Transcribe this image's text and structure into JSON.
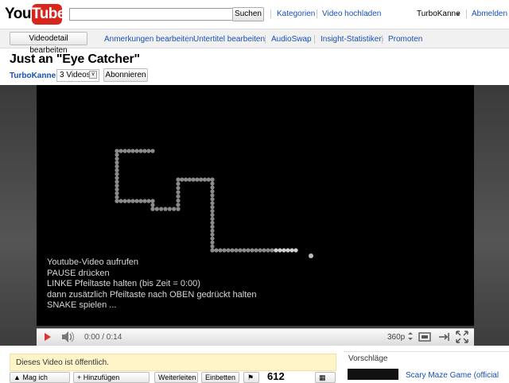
{
  "header": {
    "logo_you": "You",
    "logo_tube": "Tube",
    "search_value": "",
    "search_button": "Suchen",
    "links": [
      "Kategorien",
      "Video hochladen"
    ],
    "user": "TurboKanne",
    "logout": "Abmelden"
  },
  "actions": {
    "edit_details": "Videodetail bearbeiten",
    "links": [
      "Anmerkungen bearbeiten",
      "Untertitel bearbeiten",
      "AudioSwap",
      "Insight-Statistiken",
      "Promoten"
    ]
  },
  "video": {
    "title": "Just an \"Eye Catcher\"",
    "channel": "TurboKanne",
    "videos_count": "3 Videos",
    "subscribe": "Abonnieren"
  },
  "player": {
    "overlay_lines": [
      "Youtube-Video aufrufen",
      "PAUSE drücken",
      "LINKE Pfeiltaste halten (bis Zeit = 0:00)",
      "dann zusätzlich Pfeiltaste nach OBEN gedrückt halten",
      "SNAKE spielen ..."
    ],
    "time": "0:00 / 0:14",
    "quality": "360p",
    "progress": 0
  },
  "below": {
    "public_notice": "Dieses Video ist öffentlich.",
    "suggestions_label": "Vorschläge",
    "buttons": [
      "Mag ich",
      "Hinzufügen",
      "Weiterleiten",
      "Einbetten"
    ],
    "views": "612",
    "suggestion_title": "Scary Maze Game (official"
  },
  "colors": {
    "brand_red": "#d9261c",
    "link_blue": "#1750b5",
    "notice_bg": "#fff5c9"
  }
}
